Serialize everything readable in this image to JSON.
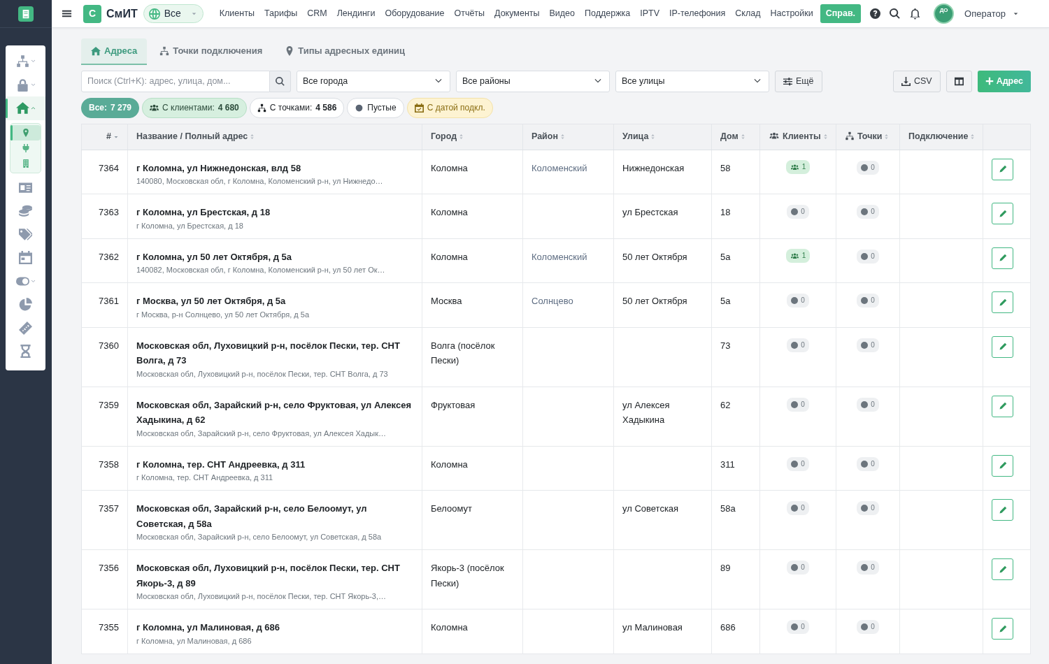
{
  "sidebar": {
    "items": [
      {
        "kind": "group",
        "selected": false,
        "expanded": false
      },
      {
        "kind": "group",
        "selected": false,
        "expanded": false
      },
      {
        "kind": "group",
        "selected": true,
        "expanded": true,
        "children": [
          {
            "selected": true
          },
          {
            "selected": false
          },
          {
            "selected": false
          }
        ]
      },
      {
        "kind": "link",
        "selected": false
      },
      {
        "kind": "link",
        "selected": false
      },
      {
        "kind": "link",
        "selected": false
      },
      {
        "kind": "link",
        "selected": false
      },
      {
        "kind": "group",
        "selected": false,
        "expanded": false
      },
      {
        "kind": "link",
        "selected": false
      },
      {
        "kind": "link",
        "selected": false
      },
      {
        "kind": "link",
        "selected": false
      }
    ]
  },
  "navbar": {
    "logo_letter": "С",
    "brand": "СмИТ",
    "scope": "Все",
    "links": [
      "Клиенты",
      "Тарифы",
      "CRM",
      "Лендинги",
      "Оборудование",
      "Отчёты",
      "Документы",
      "Видео",
      "Поддержка",
      "IPTV",
      "IP-телефония",
      "Склад",
      "Настройки"
    ],
    "help_button": "Справ.",
    "avatar": "ДО",
    "user": "Оператор"
  },
  "tabs": [
    {
      "label": "Адреса",
      "selected": true
    },
    {
      "label": "Точки подключения",
      "selected": false
    },
    {
      "label": "Типы адресных единиц",
      "selected": false
    }
  ],
  "filters": {
    "search": {
      "placeholder": "Поиск (Ctrl+K): адрес, улица, дом..."
    },
    "selects": [
      "Все города",
      "Все районы",
      "Все улицы"
    ],
    "more_button": "Ещё",
    "csv_button": "CSV",
    "add_button": "Адрес"
  },
  "chips": [
    {
      "kind": "all",
      "label": "Все:",
      "count": "7 279",
      "selected": true
    },
    {
      "kind": "clients",
      "label": "С клиентами:",
      "count": "4 680",
      "selected": false
    },
    {
      "kind": "points",
      "label": "С точками:",
      "count": "4 586",
      "selected": false
    },
    {
      "kind": "empty",
      "label": "Пустые",
      "selected": false
    },
    {
      "kind": "date",
      "label": "С датой подкл.",
      "selected": false
    }
  ],
  "table": {
    "columns": [
      {
        "label": "#",
        "kind": "text",
        "sorted": true
      },
      {
        "label": "Название / Полный адрес",
        "kind": "text",
        "sorted": false
      },
      {
        "label": "Город",
        "kind": "text",
        "sorted": false
      },
      {
        "label": "Район",
        "kind": "text",
        "sorted": false
      },
      {
        "label": "Улица",
        "kind": "text",
        "sorted": false
      },
      {
        "label": "Дом",
        "kind": "text",
        "sorted": false
      },
      {
        "label": "Клиенты",
        "kind": "clients",
        "sorted": false
      },
      {
        "label": "Точки",
        "kind": "points",
        "sorted": false
      },
      {
        "label": "Подключение",
        "kind": "text",
        "sorted": false
      }
    ],
    "rows": [
      {
        "id": "7364",
        "name": "г Коломна, ул Нижнедонская, влд 58",
        "full": "140080, Московская обл, г Коломна, Коломенский р-н, ул Нижнедо…",
        "city": "Коломна",
        "district": "Коломенский",
        "street": "Нижнедонская",
        "house": "58",
        "clients": {
          "kind": "filled",
          "count": "1"
        },
        "points": {
          "kind": "empty",
          "count": "0"
        }
      },
      {
        "id": "7363",
        "name": "г Коломна, ул Брестская, д 18",
        "full": "г Коломна, ул Брестская, д 18",
        "city": "Коломна",
        "street": "ул Брестская",
        "house": "18",
        "clients": {
          "kind": "empty",
          "count": "0"
        },
        "points": {
          "kind": "empty",
          "count": "0"
        }
      },
      {
        "id": "7362",
        "name": "г Коломна, ул 50 лет Октября, д 5а",
        "full": "140082, Московская обл, г Коломна, Коломенский р-н, ул 50 лет Ок…",
        "city": "Коломна",
        "district": "Коломенский",
        "street": "50 лет Октября",
        "house": "5а",
        "clients": {
          "kind": "filled",
          "count": "1"
        },
        "points": {
          "kind": "empty",
          "count": "0"
        }
      },
      {
        "id": "7361",
        "name": "г Москва, ул 50 лет Октября, д 5а",
        "full": "г Москва, р-н Солнцево, ул 50 лет Октября, д 5а",
        "city": "Москва",
        "district": "Солнцево",
        "street": "50 лет Октября",
        "house": "5а",
        "clients": {
          "kind": "empty",
          "count": "0"
        },
        "points": {
          "kind": "empty",
          "count": "0"
        }
      },
      {
        "id": "7360",
        "name": "Московская обл, Луховицкий р-н, посёлок Пески, тер. СНТ Волга, д 73",
        "full": "Московская обл, Луховицкий р-н, посёлок Пески, тер. СНТ Волга, д 73",
        "city": "Волга (посёлок Пески)",
        "house": "73",
        "clients": {
          "kind": "empty",
          "count": "0"
        },
        "points": {
          "kind": "empty",
          "count": "0"
        }
      },
      {
        "id": "7359",
        "name": "Московская обл, Зарайский р-н, село Фруктовая, ул Алексея Хадыкина, д 62",
        "full": "Московская обл, Зарайский р-н, село Фруктовая, ул Алексея Хадык…",
        "city": "Фруктовая",
        "street": "ул Алексея Хадыкина",
        "house": "62",
        "clients": {
          "kind": "empty",
          "count": "0"
        },
        "points": {
          "kind": "empty",
          "count": "0"
        }
      },
      {
        "id": "7358",
        "name": "г Коломна, тер. СНТ Андреевка, д 311",
        "full": "г Коломна, тер. СНТ Андреевка, д 311",
        "city": "Коломна",
        "house": "311",
        "clients": {
          "kind": "empty",
          "count": "0"
        },
        "points": {
          "kind": "empty",
          "count": "0"
        }
      },
      {
        "id": "7357",
        "name": "Московская обл, Зарайский р-н, село Белоомут, ул Советская, д 58а",
        "full": "Московская обл, Зарайский р-н, село Белоомут, ул Советская, д 58а",
        "city": "Белоомут",
        "street": "ул Советская",
        "house": "58а",
        "clients": {
          "kind": "empty",
          "count": "0"
        },
        "points": {
          "kind": "empty",
          "count": "0"
        }
      },
      {
        "id": "7356",
        "name": "Московская обл, Луховицкий р-н, посёлок Пески, тер. СНТ Якорь-3, д 89",
        "full": "Московская обл, Луховицкий р-н, посёлок Пески, тер. СНТ Якорь-3,…",
        "city": "Якорь-3 (посёлок Пески)",
        "house": "89",
        "clients": {
          "kind": "empty",
          "count": "0"
        },
        "points": {
          "kind": "empty",
          "count": "0"
        }
      },
      {
        "id": "7355",
        "name": "г Коломна, ул Малиновая, д 686",
        "full": "г Коломна, ул Малиновая, д 686",
        "city": "Коломна",
        "street": "ул Малиновая",
        "house": "686",
        "clients": {
          "kind": "empty",
          "count": "0"
        },
        "points": {
          "kind": "empty",
          "count": "0"
        }
      }
    ]
  }
}
